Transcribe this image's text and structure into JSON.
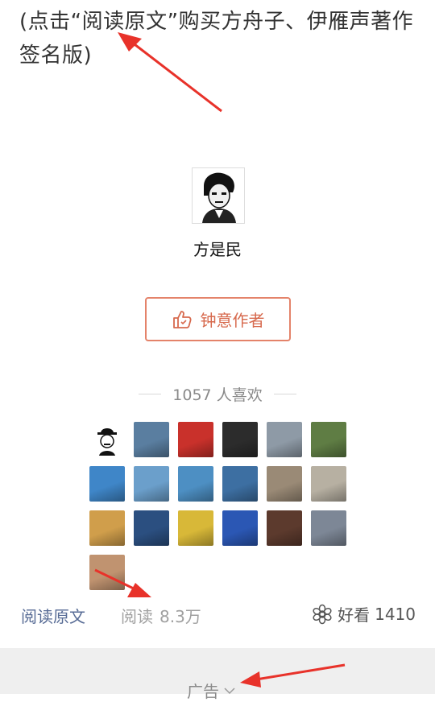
{
  "article": {
    "promo_text": "(点击“阅读原文”购买方舟子、伊雁声著作签名版)"
  },
  "author": {
    "name": "方是民",
    "reward_button_label": "钟意作者"
  },
  "likes": {
    "count_text": "1057 人喜欢",
    "tiles": [
      {
        "color": "#ffffff",
        "icon": "cartoon-avatar"
      },
      {
        "color": "#5a7ea0",
        "icon": "person-photo"
      },
      {
        "color": "#c9312b",
        "icon": "red-photo"
      },
      {
        "color": "#2c2c2c",
        "icon": "dark-photo"
      },
      {
        "color": "#8e9aa6",
        "icon": "landscape-photo"
      },
      {
        "color": "#5f7d44",
        "icon": "tree-photo"
      },
      {
        "color": "#3f86c8",
        "icon": "minions-photo"
      },
      {
        "color": "#6b9fcb",
        "icon": "travel-photo"
      },
      {
        "color": "#4d8fc3",
        "icon": "sky-photo"
      },
      {
        "color": "#3d6fa2",
        "icon": "person-blue-photo"
      },
      {
        "color": "#9a8a76",
        "icon": "building-photo"
      },
      {
        "color": "#b7b0a2",
        "icon": "flowers-photo"
      },
      {
        "color": "#d09e4b",
        "icon": "gate-photo"
      },
      {
        "color": "#2b4f80",
        "icon": "night-sky-photo"
      },
      {
        "color": "#d8b838",
        "icon": "child-photo"
      },
      {
        "color": "#2b57b4",
        "icon": "blue-rose-photo"
      },
      {
        "color": "#5c3a2d",
        "icon": "person-photo-2"
      },
      {
        "color": "#7d8796",
        "icon": "seaside-photo"
      },
      {
        "color": "#c09370",
        "icon": "dog-photo"
      }
    ]
  },
  "footer": {
    "read_original": "阅读原文",
    "read_label": "阅读",
    "read_count": "8.3万",
    "haokan_label": "好看",
    "haokan_count": "1410"
  },
  "ad": {
    "label": "广告"
  }
}
